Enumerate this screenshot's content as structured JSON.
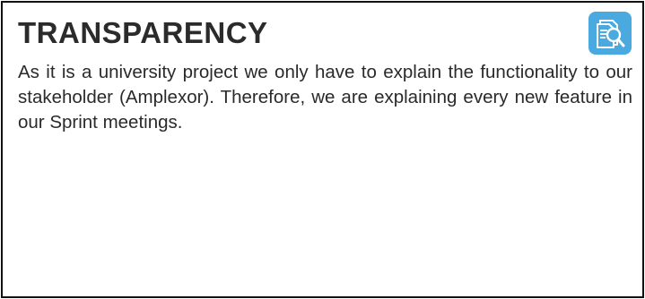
{
  "card": {
    "title": "TRANSPARENCY",
    "body": "As it is a university project we only have to explain the functionality to our stakeholder (Amplexor). Therefore, we are explaining every new feature in our Sprint meetings.",
    "icon": "document-search-icon",
    "icon_color": "#4aa9df",
    "border_color": "#111111",
    "title_color": "#2b2b2b",
    "text_color": "#2a2a2a"
  }
}
